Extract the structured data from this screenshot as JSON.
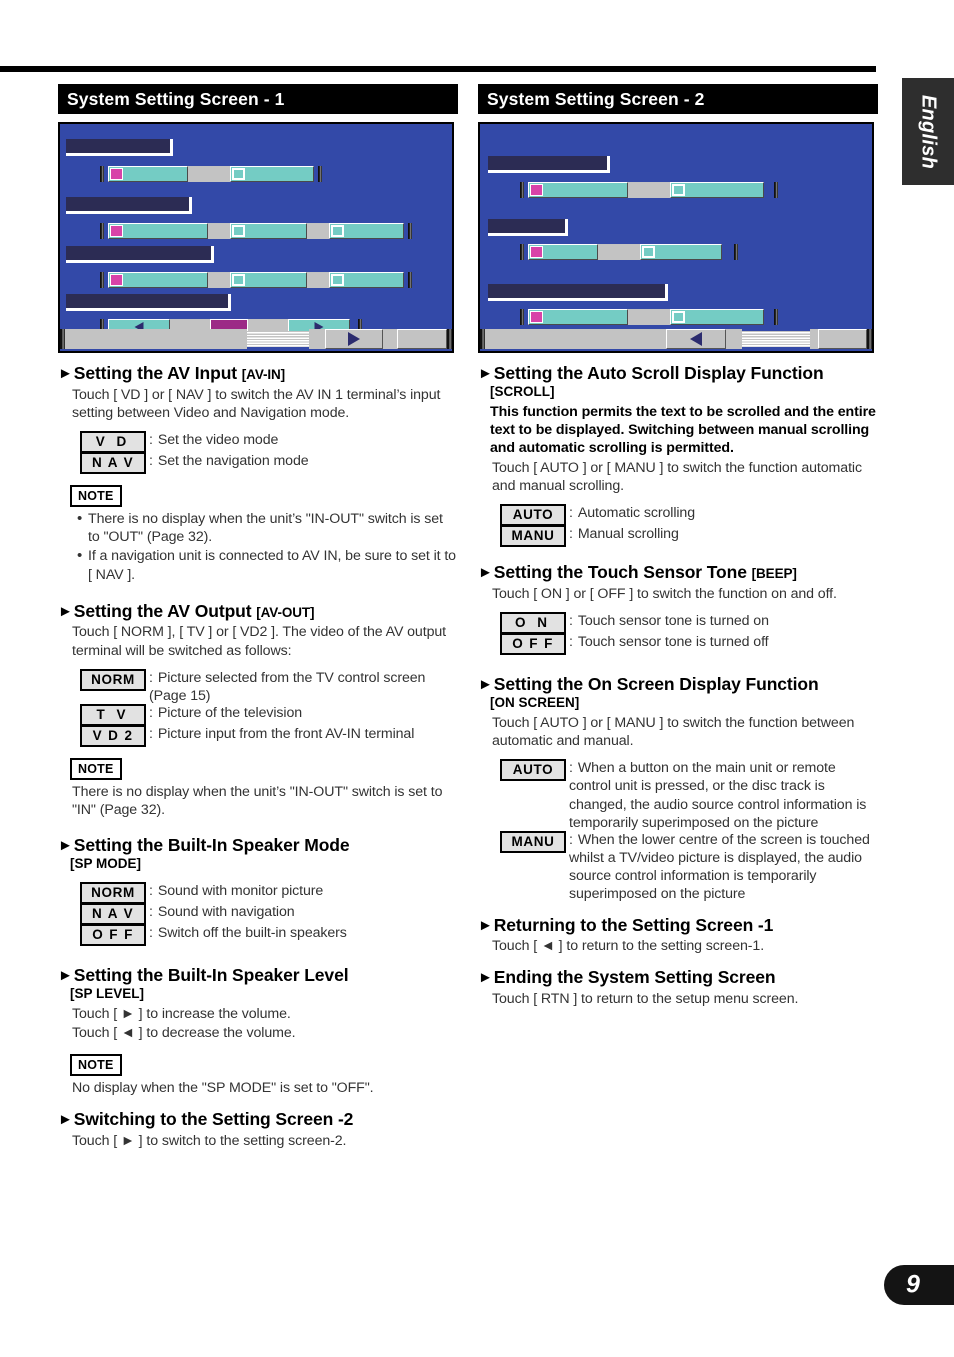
{
  "margin": {
    "language_tab": "English",
    "page_number": "9"
  },
  "left": {
    "banner": "System Setting Screen - 1",
    "sections": [
      {
        "heading": "Setting the AV Input",
        "tag_inline": "[AV-IN]",
        "body": "Touch [ VD ] or [ NAV ] to switch the AV IN 1 terminal’s input setting between Video and Navigation mode.",
        "keys": [
          {
            "cap": "V   D",
            "desc": "Set the video mode"
          },
          {
            "cap": "N A V",
            "desc": "Set the navigation mode"
          }
        ],
        "note_label": "NOTE",
        "note_items": [
          "There is no display when the unit’s \"IN-OUT\" switch is set to \"OUT\" (Page 32).",
          "If a navigation unit is connected to AV IN, be sure to set it to [ NAV ]."
        ]
      },
      {
        "heading": "Setting the AV Output",
        "tag_inline": "[AV-OUT]",
        "body": "Touch [ NORM ], [ TV ] or [ VD2 ]. The video of the AV output terminal will be switched as follows:",
        "keys": [
          {
            "cap": "NORM",
            "desc": "Picture selected from the TV control screen (Page 15)"
          },
          {
            "cap": "T   V",
            "desc": "Picture of the television"
          },
          {
            "cap": "V D 2",
            "desc": "Picture input from the front AV-IN terminal"
          }
        ],
        "note_label": "NOTE",
        "note_plain": "There is no display when the unit’s \"IN-OUT\" switch is set to \"IN\" (Page 32)."
      },
      {
        "heading": "Setting the Built-In Speaker Mode",
        "subtag": "[SP MODE]",
        "keys": [
          {
            "cap": "NORM",
            "desc": "Sound with monitor picture"
          },
          {
            "cap": "N A V",
            "desc": "Sound with navigation"
          },
          {
            "cap": "O F F",
            "desc": "Switch off the built-in speakers"
          }
        ]
      },
      {
        "heading": "Setting the Built-In Speaker Level",
        "subtag": "[SP LEVEL]",
        "body_lines": [
          "Touch [ ► ] to increase the volume.",
          "Touch [ ◄ ] to decrease the volume."
        ],
        "note_label": "NOTE",
        "note_plain": "No display when the \"SP MODE\" is set to \"OFF\"."
      },
      {
        "heading": "Switching to the Setting Screen -2",
        "body": "Touch [ ► ] to switch to the setting screen-2."
      }
    ]
  },
  "right": {
    "banner": "System Setting Screen - 2",
    "sections": [
      {
        "heading": "Setting the Auto Scroll Display Function",
        "subtag": "[SCROLL]",
        "bold_body": "This function permits the text to be scrolled and the entire text to be displayed. Switching between manual scrolling and automatic scrolling is permitted.",
        "body": "Touch [ AUTO ] or [ MANU ] to switch the function automatic and manual scrolling.",
        "keys": [
          {
            "cap": "AUTO",
            "desc": "Automatic scrolling"
          },
          {
            "cap": "MANU",
            "desc": "Manual scrolling"
          }
        ]
      },
      {
        "heading": "Setting the Touch Sensor Tone",
        "tag_inline": "[BEEP]",
        "body": "Touch [ ON ] or [ OFF ] to switch the function on and off.",
        "keys": [
          {
            "cap": "O   N",
            "desc": "Touch sensor tone is turned on"
          },
          {
            "cap": "O F F",
            "desc": "Touch sensor tone is turned off"
          }
        ]
      },
      {
        "heading": "Setting the On Screen Display Function",
        "subtag": "[ON SCREEN]",
        "body": "Touch [ AUTO ] or [ MANU ] to switch the function between automatic and manual.",
        "keys": [
          {
            "cap": "AUTO",
            "desc": "When a button on the main unit or remote control unit is pressed, or the disc track is changed, the audio source control information is temporarily superimposed on the picture"
          },
          {
            "cap": "MANU",
            "desc": "When the lower centre of the screen is touched whilst a TV/video picture is displayed, the audio source control information is temporarily superimposed on the picture"
          }
        ]
      },
      {
        "heading": "Returning to the Setting Screen -1",
        "body": "Touch [ ◄ ] to return to the setting screen-1."
      },
      {
        "heading": "Ending the System Setting Screen",
        "body": "Touch [ RTN ] to return to the setup menu screen."
      }
    ]
  },
  "colors": {
    "screen_background": "#3349a8",
    "plate": "#2c2c54",
    "key_teal": "#74ccc4",
    "key_pink": "#d843a8",
    "key_grey": "#c3c3c3",
    "key_magenta": "#9c2a86",
    "banner_background": "#000000"
  }
}
